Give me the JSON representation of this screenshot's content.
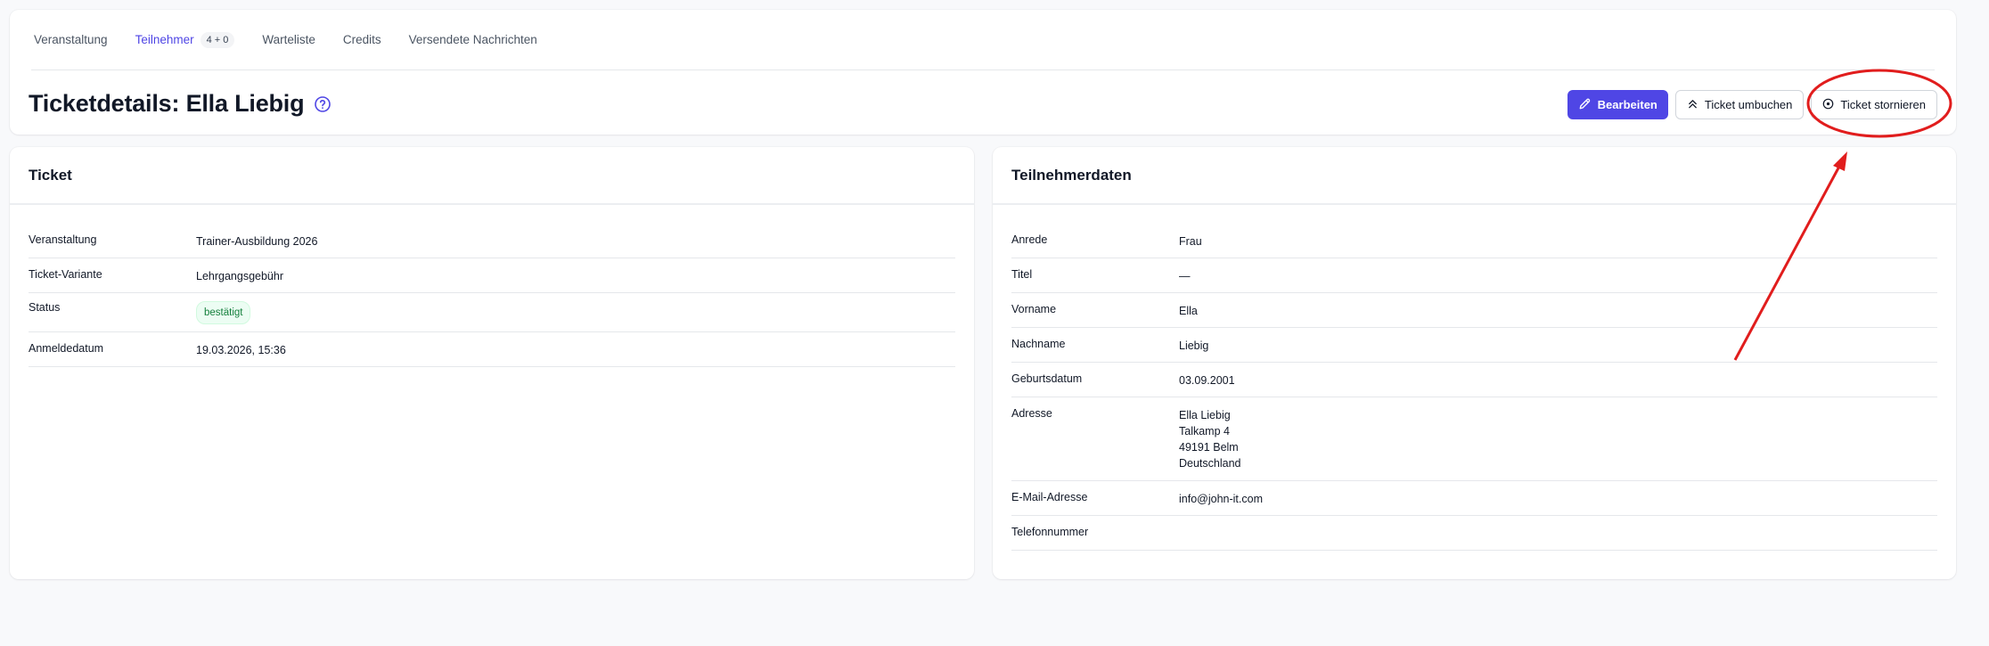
{
  "tabs": [
    {
      "label": "Veranstaltung"
    },
    {
      "label": "Teilnehmer",
      "badge": "4 + 0"
    },
    {
      "label": "Warteliste"
    },
    {
      "label": "Credits"
    },
    {
      "label": "Versendete Nachrichten"
    }
  ],
  "page": {
    "title": "Ticketdetails: Ella Liebig",
    "help_icon": "question-circle-icon"
  },
  "actions": {
    "edit_label": "Bearbeiten",
    "rebook_label": "Ticket umbuchen",
    "cancel_label": "Ticket stornieren"
  },
  "ticket": {
    "header": "Ticket",
    "rows": [
      {
        "key": "Veranstaltung",
        "value": "Trainer-Ausbildung 2026"
      },
      {
        "key": "Ticket-Variante",
        "value": "Lehrgangsgebühr"
      },
      {
        "key": "Status",
        "value": "bestätigt"
      },
      {
        "key": "Anmeldedatum",
        "value": "19.03.2026, 15:36"
      }
    ]
  },
  "participant": {
    "header": "Teilnehmerdaten",
    "rows": [
      {
        "key": "Anrede",
        "value": "Frau"
      },
      {
        "key": "Titel",
        "value": "—"
      },
      {
        "key": "Vorname",
        "value": "Ella"
      },
      {
        "key": "Nachname",
        "value": "Liebig"
      },
      {
        "key": "Geburtsdatum",
        "value": "03.09.2001"
      },
      {
        "key": "Adresse",
        "lines": [
          "Ella Liebig",
          "Talkamp 4",
          "49191 Belm",
          "Deutschland"
        ]
      },
      {
        "key": "E-Mail-Adresse",
        "value": "info@john-it.com"
      },
      {
        "key": "Telefonnummer",
        "value": ""
      }
    ]
  },
  "colors": {
    "accent": "#4f46e5",
    "status_green": "#15803d",
    "annotation_red": "#e11d1d"
  }
}
